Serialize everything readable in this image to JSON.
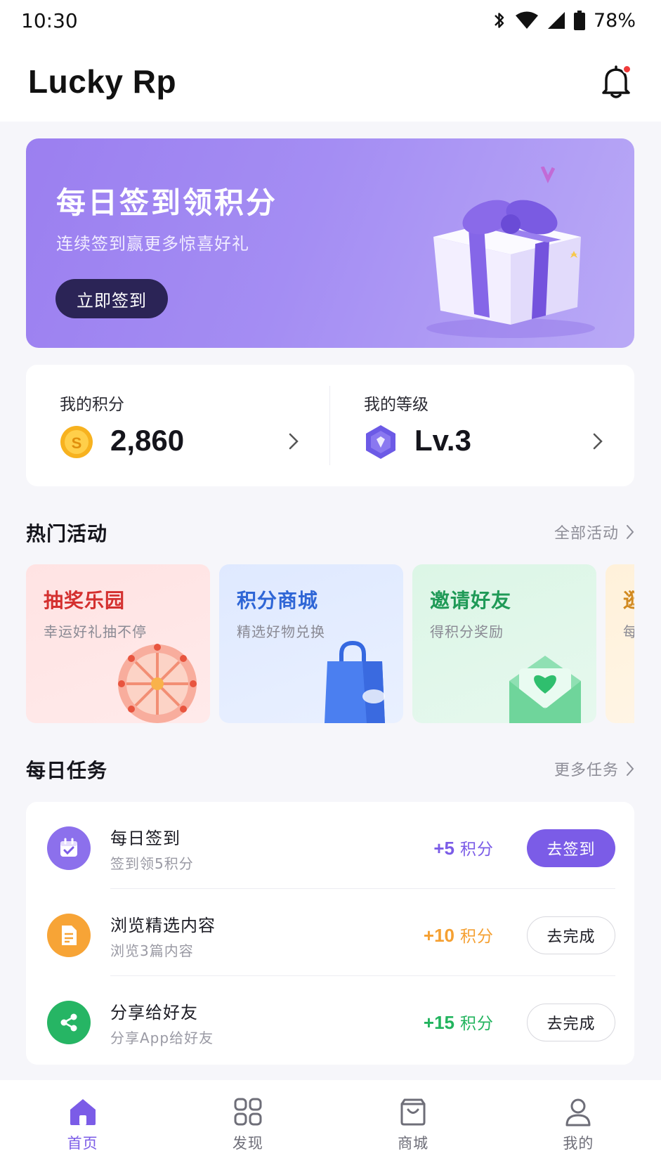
{
  "status_bar": {
    "time": "10:30",
    "battery": "78%"
  },
  "header": {
    "title": "Lucky Rp"
  },
  "banner": {
    "title": "每日签到领积分",
    "subtitle": "连续签到赢更多惊喜好礼",
    "button_label": "立即签到"
  },
  "stats": {
    "points_label": "我的积分",
    "points_value": "2,860",
    "level_label": "我的等级",
    "level_value": "Lv.3"
  },
  "hot_section": {
    "title": "热门活动",
    "more_label": "全部活动"
  },
  "activities": [
    {
      "title": "抽奖乐园",
      "subtitle": "幸运好礼抽不停",
      "color": "#d4302f"
    },
    {
      "title": "积分商城",
      "subtitle": "精选好物兑换",
      "color": "#2f66d6"
    },
    {
      "title": "邀请好友",
      "subtitle": "得积分奖励",
      "color": "#1f9a57"
    },
    {
      "title": "逛",
      "subtitle": "每",
      "color": "#d1891f"
    }
  ],
  "task_section": {
    "title": "每日任务",
    "more_label": "更多任务"
  },
  "tasks": [
    {
      "name": "每日签到",
      "desc": "签到领5积分",
      "points": "+5",
      "unit": "积分",
      "button": "去签到",
      "color": "#7b5ce7",
      "icon": "calendar-icon"
    },
    {
      "name": "浏览精选内容",
      "desc": "浏览3篇内容",
      "points": "+10",
      "unit": "积分",
      "button": "去完成",
      "color": "#f5a032",
      "icon": "document-icon"
    },
    {
      "name": "分享给好友",
      "desc": "分享App给好友",
      "points": "+15",
      "unit": "积分",
      "button": "去完成",
      "color": "#22b45e",
      "icon": "share-icon"
    }
  ],
  "nav": [
    {
      "label": "首页",
      "icon": "home-icon",
      "active": true
    },
    {
      "label": "发现",
      "icon": "discover-icon",
      "active": false
    },
    {
      "label": "商城",
      "icon": "shop-bag-icon",
      "active": false
    },
    {
      "label": "我的",
      "icon": "profile-icon",
      "active": false
    }
  ]
}
